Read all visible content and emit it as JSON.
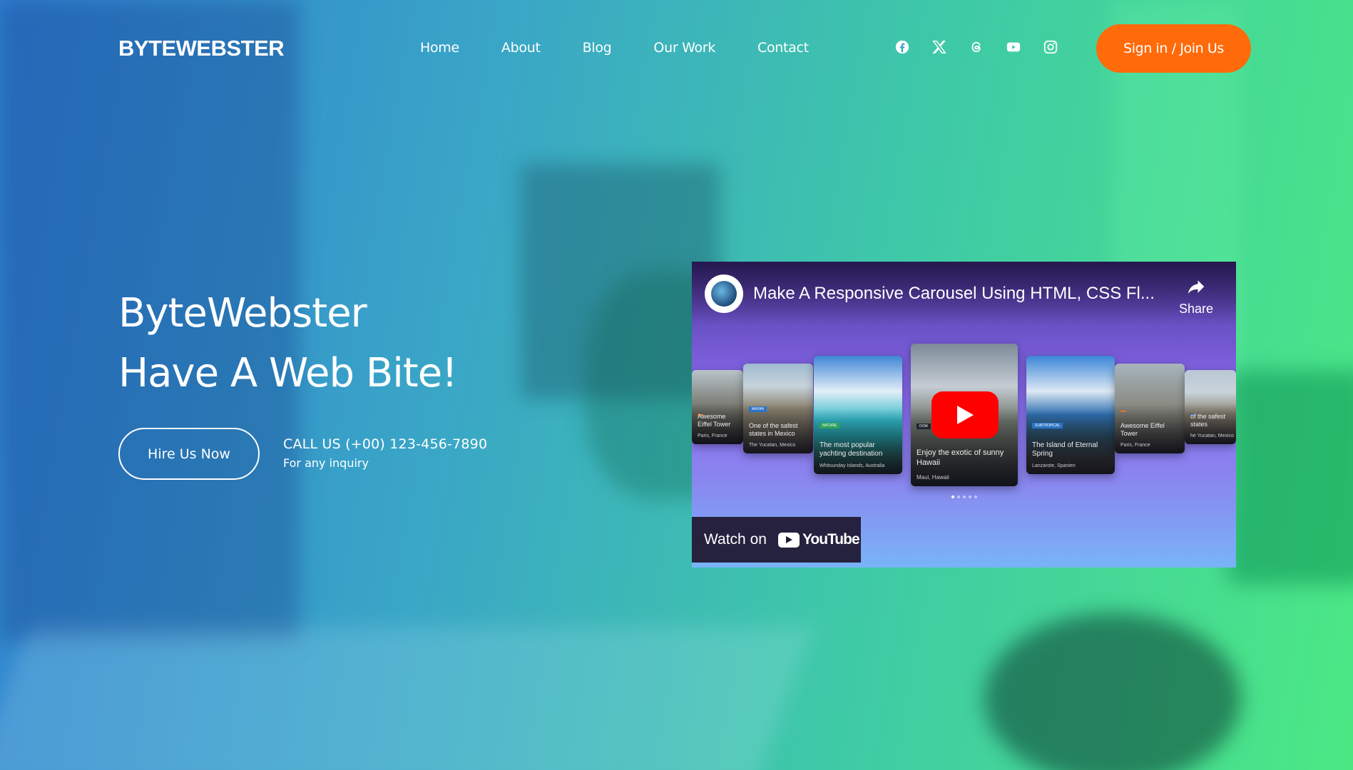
{
  "brand": {
    "logo_text": "BYTEWEBSTER"
  },
  "nav": {
    "items": [
      {
        "label": "Home"
      },
      {
        "label": "About"
      },
      {
        "label": "Blog"
      },
      {
        "label": "Our Work"
      },
      {
        "label": "Contact"
      }
    ]
  },
  "socials": [
    "facebook-icon",
    "x-icon",
    "threads-icon",
    "youtube-icon",
    "instagram-icon"
  ],
  "header": {
    "cta_label": "Sign in / Join Us"
  },
  "hero": {
    "title_line1": "ByteWebster",
    "title_line2": "Have A Web Bite!",
    "hire_label": "Hire Us Now",
    "call_text": "CALL US (+00) 123-456-7890",
    "call_sub": "For any inquiry"
  },
  "video": {
    "title": "Make A Responsive Carousel Using HTML, CSS Fl...",
    "share_label": "Share",
    "watch_label": "Watch on",
    "youtube_word": "YouTube",
    "cards": [
      {
        "caption": "Awesome Eiffel Tower",
        "location": "Paris, France",
        "tag": ""
      },
      {
        "caption": "One of the safest states in Mexico",
        "location": "The Yucatan, Mexico",
        "tag": "MAYAN"
      },
      {
        "caption": "The most popular yachting destination",
        "location": "Whitsunday Islands, Australia",
        "tag": "NATURE"
      },
      {
        "caption": "Enjoy the exotic of sunny Hawaii",
        "location": "Maui, Hawaii",
        "tag": "DOM"
      },
      {
        "caption": "The Island of Eternal Spring",
        "location": "Lanzarote, Spanien",
        "tag": "SUBTROPICAL"
      },
      {
        "caption": "Awesome Eiffel Tower",
        "location": "Paris, France",
        "tag": ""
      },
      {
        "caption": "of the safest states",
        "location": "he Yucatan, Mexico",
        "tag": ""
      }
    ]
  },
  "colors": {
    "cta": "#ff6b0b",
    "gradient_start": "#2f7fd0",
    "gradient_end": "#4ce884",
    "youtube_red": "#ff0000"
  }
}
